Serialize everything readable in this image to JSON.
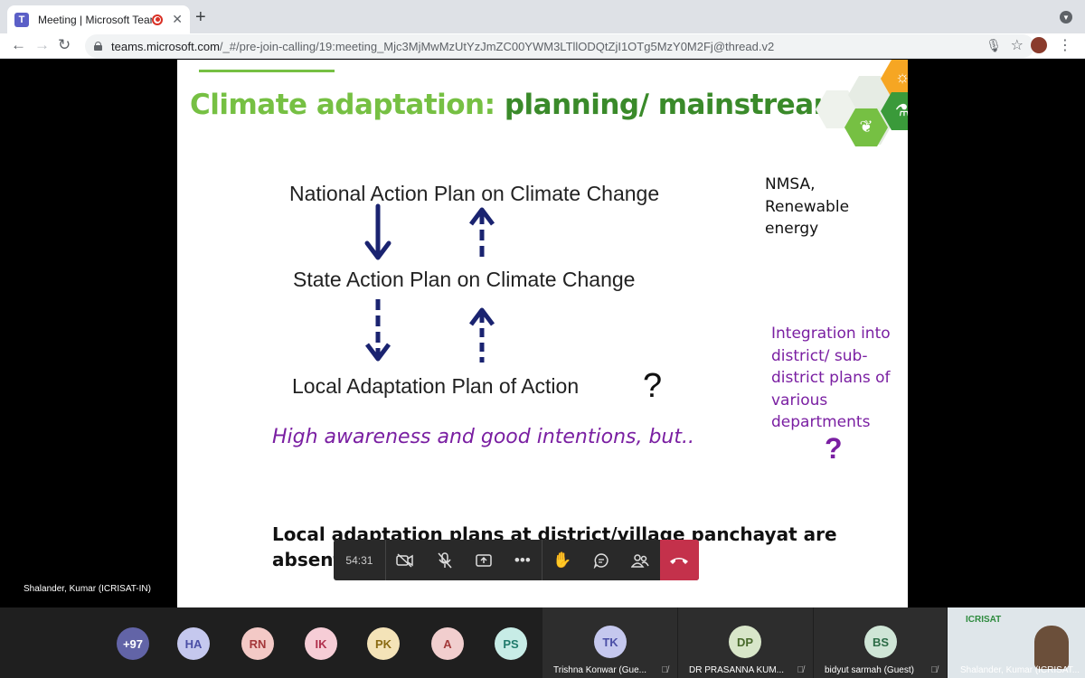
{
  "browser": {
    "tab_title": "Meeting | Microsoft Teams",
    "tab_close": "✕",
    "new_tab": "+",
    "url_host": "teams.microsoft.com",
    "url_path": "/_#/pre-join-calling/19:meeting_Mjc3MjMwMzUtYzJmZC00YWM3LTllODQtZjI1OTg5MzY0M2Fj@thread.v2"
  },
  "slide": {
    "title_part1": "Climate adaptation: ",
    "title_part2": "planning/ mainstreaming",
    "national": "National Action Plan on Climate Change",
    "state": "State Action Plan on Climate Change",
    "local": "Local Adaptation Plan of Action",
    "question1": "?",
    "nmsa": "NMSA,\nRenewable\nenergy",
    "integration": "Integration into\ndistrict/ sub-\ndistrict plans of\nvarious\ndepartments",
    "question2": "?",
    "awareness": "High awareness and good intentions, but..",
    "bottom": "Local adaptation plans at district/village panchayat are absent in most states",
    "colors": {
      "green_light": "#76c043",
      "green_dark": "#3a8a2a",
      "purple": "#7a1fa2",
      "navy": "#1a2370"
    }
  },
  "meeting": {
    "presenter_label": "Shalander, Kumar (ICRISAT-IN)",
    "timer": "54:31",
    "controls": [
      "camera-off-icon",
      "mic-off-icon",
      "share-icon",
      "more-icon",
      "raise-hand-icon",
      "chat-icon",
      "participants-icon",
      "hangup-icon"
    ]
  },
  "participants": {
    "overflow": "+97",
    "avatars": [
      {
        "initials": "HA",
        "color": "#c5c8ee",
        "text": "#4b4fa6"
      },
      {
        "initials": "RN",
        "color": "#f3c9c6",
        "text": "#a4373a"
      },
      {
        "initials": "IK",
        "color": "#f6cdd6",
        "text": "#b0304d"
      },
      {
        "initials": "PK",
        "color": "#f4e3b8",
        "text": "#8a6a12"
      },
      {
        "initials": "A",
        "color": "#f1cece",
        "text": "#a33a3a"
      },
      {
        "initials": "PS",
        "color": "#c7ece6",
        "text": "#1f7a6b"
      }
    ],
    "tiles": [
      {
        "initials": "TK",
        "name": "Trishna Konwar (Gue...",
        "color": "#c5c8ee",
        "text": "#4b4fa6"
      },
      {
        "initials": "DP",
        "name": "DR PRASANNA KUM...",
        "color": "#d8e6c9",
        "text": "#47692a"
      },
      {
        "initials": "BS",
        "name": "bidyut sarmah (Guest)",
        "color": "#cfe5d6",
        "text": "#2b6b45"
      }
    ],
    "video": {
      "name": "Shalander, Kumar (ICRISAT...",
      "logo": "ICRISAT"
    }
  }
}
